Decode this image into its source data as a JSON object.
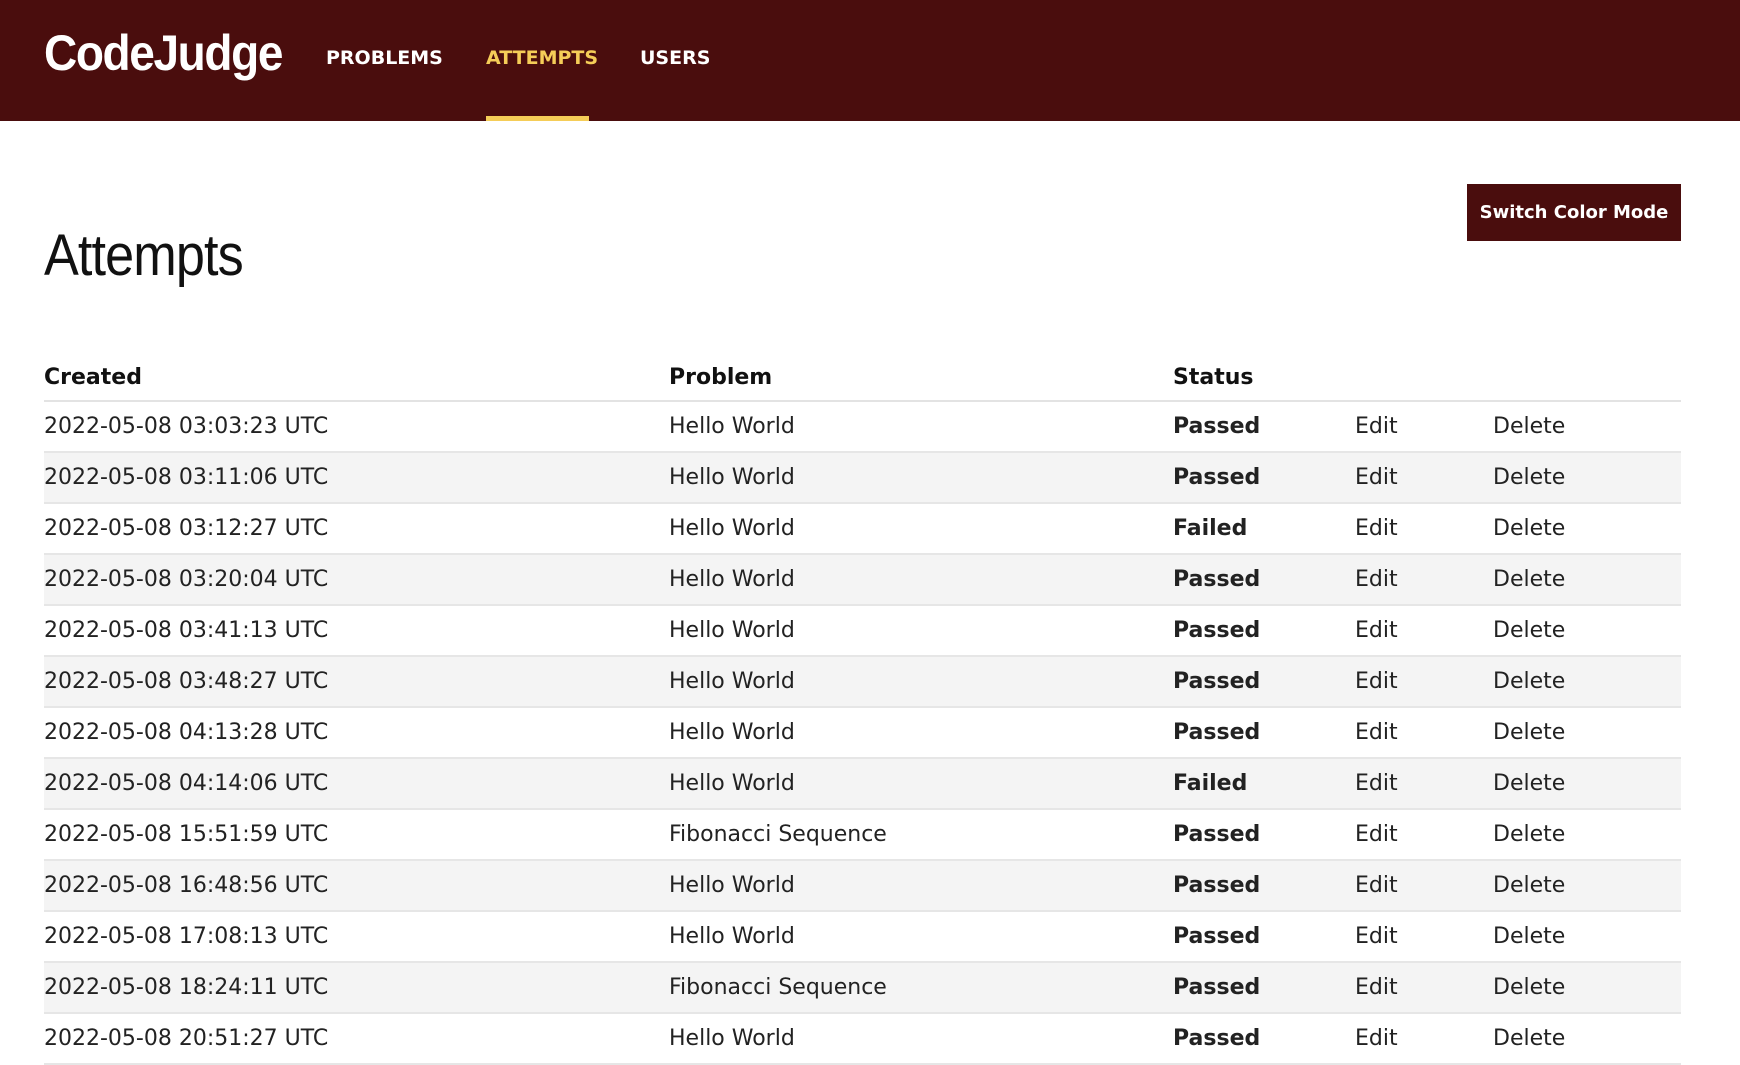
{
  "app": {
    "brand": "CodeJudge",
    "nav": [
      {
        "label": "PROBLEMS",
        "active": false
      },
      {
        "label": "ATTEMPTS",
        "active": true
      },
      {
        "label": "USERS",
        "active": false
      }
    ]
  },
  "colors": {
    "navbar_bg": "#4a0d0d",
    "active_accent": "#f5cd58",
    "passed": "#5fbf83",
    "failed": "#d32a3c"
  },
  "page": {
    "title": "Attempts",
    "switch_button": "Switch Color Mode"
  },
  "table": {
    "headers": {
      "created": "Created",
      "problem": "Problem",
      "status": "Status"
    },
    "rows": [
      {
        "created": "2022-05-08 03:03:23 UTC",
        "problem": "Hello World",
        "status": "Passed",
        "edit": "Edit",
        "delete": "Delete"
      },
      {
        "created": "2022-05-08 03:11:06 UTC",
        "problem": "Hello World",
        "status": "Passed",
        "edit": "Edit",
        "delete": "Delete"
      },
      {
        "created": "2022-05-08 03:12:27 UTC",
        "problem": "Hello World",
        "status": "Failed",
        "edit": "Edit",
        "delete": "Delete"
      },
      {
        "created": "2022-05-08 03:20:04 UTC",
        "problem": "Hello World",
        "status": "Passed",
        "edit": "Edit",
        "delete": "Delete"
      },
      {
        "created": "2022-05-08 03:41:13 UTC",
        "problem": "Hello World",
        "status": "Passed",
        "edit": "Edit",
        "delete": "Delete"
      },
      {
        "created": "2022-05-08 03:48:27 UTC",
        "problem": "Hello World",
        "status": "Passed",
        "edit": "Edit",
        "delete": "Delete"
      },
      {
        "created": "2022-05-08 04:13:28 UTC",
        "problem": "Hello World",
        "status": "Passed",
        "edit": "Edit",
        "delete": "Delete"
      },
      {
        "created": "2022-05-08 04:14:06 UTC",
        "problem": "Hello World",
        "status": "Failed",
        "edit": "Edit",
        "delete": "Delete"
      },
      {
        "created": "2022-05-08 15:51:59 UTC",
        "problem": "Fibonacci Sequence",
        "status": "Passed",
        "edit": "Edit",
        "delete": "Delete"
      },
      {
        "created": "2022-05-08 16:48:56 UTC",
        "problem": "Hello World",
        "status": "Passed",
        "edit": "Edit",
        "delete": "Delete"
      },
      {
        "created": "2022-05-08 17:08:13 UTC",
        "problem": "Hello World",
        "status": "Passed",
        "edit": "Edit",
        "delete": "Delete"
      },
      {
        "created": "2022-05-08 18:24:11 UTC",
        "problem": "Fibonacci Sequence",
        "status": "Passed",
        "edit": "Edit",
        "delete": "Delete"
      },
      {
        "created": "2022-05-08 20:51:27 UTC",
        "problem": "Hello World",
        "status": "Passed",
        "edit": "Edit",
        "delete": "Delete"
      }
    ]
  }
}
